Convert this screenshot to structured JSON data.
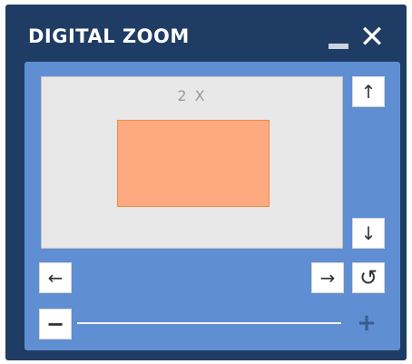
{
  "window": {
    "title": "DIGITAL ZOOM",
    "minimize_icon": "minimize-icon",
    "close_glyph": "✕"
  },
  "preview": {
    "zoom_label": "2 X"
  },
  "controls": {
    "up_glyph": "↑",
    "down_glyph": "↓",
    "left_glyph": "←",
    "right_glyph": "→",
    "reset_glyph": "↺",
    "zoom_out_glyph": "−",
    "zoom_in_glyph": "+"
  },
  "zoom_slider": {
    "level": 0
  },
  "colors": {
    "window_background": "#1f3c65",
    "panel_background": "#5f8ed2",
    "preview_background": "#e8e8e8",
    "viewport_fill": "#fdaa80"
  }
}
